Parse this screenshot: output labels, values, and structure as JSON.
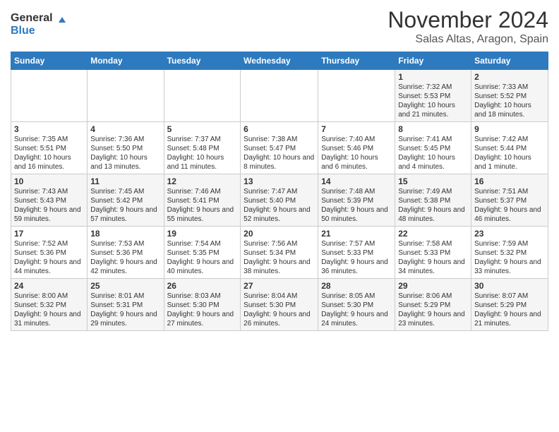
{
  "header": {
    "logo": {
      "line1": "General",
      "line2": "Blue"
    },
    "title": "November 2024",
    "subtitle": "Salas Altas, Aragon, Spain"
  },
  "days_of_week": [
    "Sunday",
    "Monday",
    "Tuesday",
    "Wednesday",
    "Thursday",
    "Friday",
    "Saturday"
  ],
  "weeks": [
    [
      {
        "day": "",
        "info": ""
      },
      {
        "day": "",
        "info": ""
      },
      {
        "day": "",
        "info": ""
      },
      {
        "day": "",
        "info": ""
      },
      {
        "day": "",
        "info": ""
      },
      {
        "day": "1",
        "info": "Sunrise: 7:32 AM\nSunset: 5:53 PM\nDaylight: 10 hours and 21 minutes."
      },
      {
        "day": "2",
        "info": "Sunrise: 7:33 AM\nSunset: 5:52 PM\nDaylight: 10 hours and 18 minutes."
      }
    ],
    [
      {
        "day": "3",
        "info": "Sunrise: 7:35 AM\nSunset: 5:51 PM\nDaylight: 10 hours and 16 minutes."
      },
      {
        "day": "4",
        "info": "Sunrise: 7:36 AM\nSunset: 5:50 PM\nDaylight: 10 hours and 13 minutes."
      },
      {
        "day": "5",
        "info": "Sunrise: 7:37 AM\nSunset: 5:48 PM\nDaylight: 10 hours and 11 minutes."
      },
      {
        "day": "6",
        "info": "Sunrise: 7:38 AM\nSunset: 5:47 PM\nDaylight: 10 hours and 8 minutes."
      },
      {
        "day": "7",
        "info": "Sunrise: 7:40 AM\nSunset: 5:46 PM\nDaylight: 10 hours and 6 minutes."
      },
      {
        "day": "8",
        "info": "Sunrise: 7:41 AM\nSunset: 5:45 PM\nDaylight: 10 hours and 4 minutes."
      },
      {
        "day": "9",
        "info": "Sunrise: 7:42 AM\nSunset: 5:44 PM\nDaylight: 10 hours and 1 minute."
      }
    ],
    [
      {
        "day": "10",
        "info": "Sunrise: 7:43 AM\nSunset: 5:43 PM\nDaylight: 9 hours and 59 minutes."
      },
      {
        "day": "11",
        "info": "Sunrise: 7:45 AM\nSunset: 5:42 PM\nDaylight: 9 hours and 57 minutes."
      },
      {
        "day": "12",
        "info": "Sunrise: 7:46 AM\nSunset: 5:41 PM\nDaylight: 9 hours and 55 minutes."
      },
      {
        "day": "13",
        "info": "Sunrise: 7:47 AM\nSunset: 5:40 PM\nDaylight: 9 hours and 52 minutes."
      },
      {
        "day": "14",
        "info": "Sunrise: 7:48 AM\nSunset: 5:39 PM\nDaylight: 9 hours and 50 minutes."
      },
      {
        "day": "15",
        "info": "Sunrise: 7:49 AM\nSunset: 5:38 PM\nDaylight: 9 hours and 48 minutes."
      },
      {
        "day": "16",
        "info": "Sunrise: 7:51 AM\nSunset: 5:37 PM\nDaylight: 9 hours and 46 minutes."
      }
    ],
    [
      {
        "day": "17",
        "info": "Sunrise: 7:52 AM\nSunset: 5:36 PM\nDaylight: 9 hours and 44 minutes."
      },
      {
        "day": "18",
        "info": "Sunrise: 7:53 AM\nSunset: 5:36 PM\nDaylight: 9 hours and 42 minutes."
      },
      {
        "day": "19",
        "info": "Sunrise: 7:54 AM\nSunset: 5:35 PM\nDaylight: 9 hours and 40 minutes."
      },
      {
        "day": "20",
        "info": "Sunrise: 7:56 AM\nSunset: 5:34 PM\nDaylight: 9 hours and 38 minutes."
      },
      {
        "day": "21",
        "info": "Sunrise: 7:57 AM\nSunset: 5:33 PM\nDaylight: 9 hours and 36 minutes."
      },
      {
        "day": "22",
        "info": "Sunrise: 7:58 AM\nSunset: 5:33 PM\nDaylight: 9 hours and 34 minutes."
      },
      {
        "day": "23",
        "info": "Sunrise: 7:59 AM\nSunset: 5:32 PM\nDaylight: 9 hours and 33 minutes."
      }
    ],
    [
      {
        "day": "24",
        "info": "Sunrise: 8:00 AM\nSunset: 5:32 PM\nDaylight: 9 hours and 31 minutes."
      },
      {
        "day": "25",
        "info": "Sunrise: 8:01 AM\nSunset: 5:31 PM\nDaylight: 9 hours and 29 minutes."
      },
      {
        "day": "26",
        "info": "Sunrise: 8:03 AM\nSunset: 5:30 PM\nDaylight: 9 hours and 27 minutes."
      },
      {
        "day": "27",
        "info": "Sunrise: 8:04 AM\nSunset: 5:30 PM\nDaylight: 9 hours and 26 minutes."
      },
      {
        "day": "28",
        "info": "Sunrise: 8:05 AM\nSunset: 5:30 PM\nDaylight: 9 hours and 24 minutes."
      },
      {
        "day": "29",
        "info": "Sunrise: 8:06 AM\nSunset: 5:29 PM\nDaylight: 9 hours and 23 minutes."
      },
      {
        "day": "30",
        "info": "Sunrise: 8:07 AM\nSunset: 5:29 PM\nDaylight: 9 hours and 21 minutes."
      }
    ]
  ]
}
